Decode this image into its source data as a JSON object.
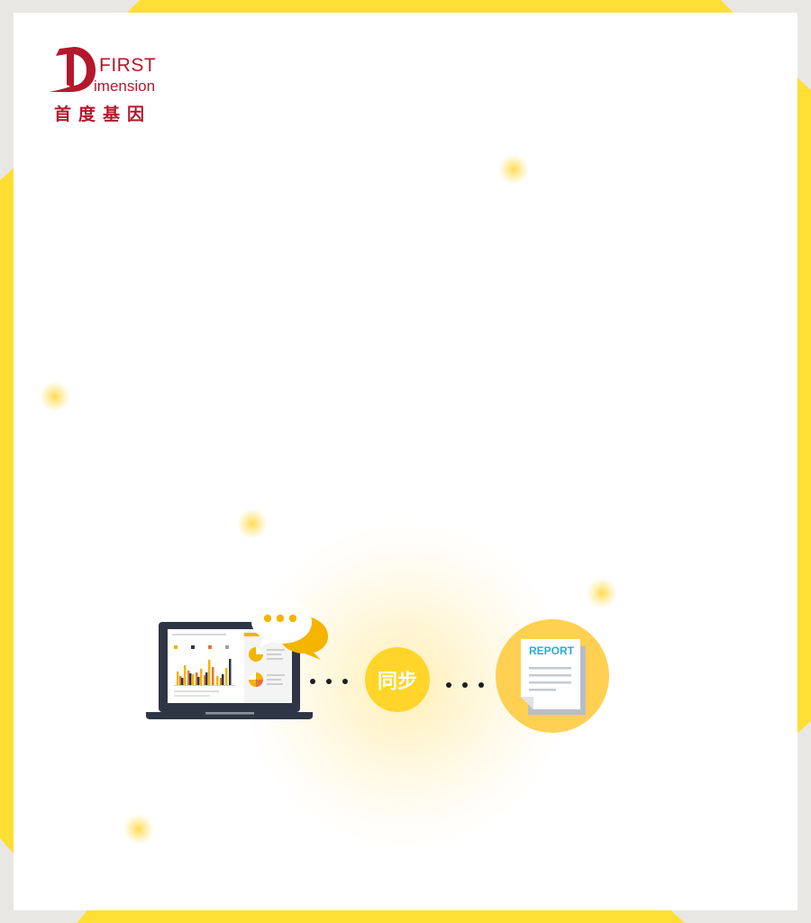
{
  "logo": {
    "word_first": "FIRST",
    "word_imension": "imension",
    "chinese_name": "首度基因",
    "brand_color": "#b5172c"
  },
  "diagram": {
    "sync_label": "同步",
    "report_label": "REPORT",
    "accent_color": "#ffd52a",
    "report_label_color": "#2fa9d6",
    "icons": [
      "laptop-icon",
      "speech-bubble-icon",
      "report-document-icon"
    ]
  }
}
